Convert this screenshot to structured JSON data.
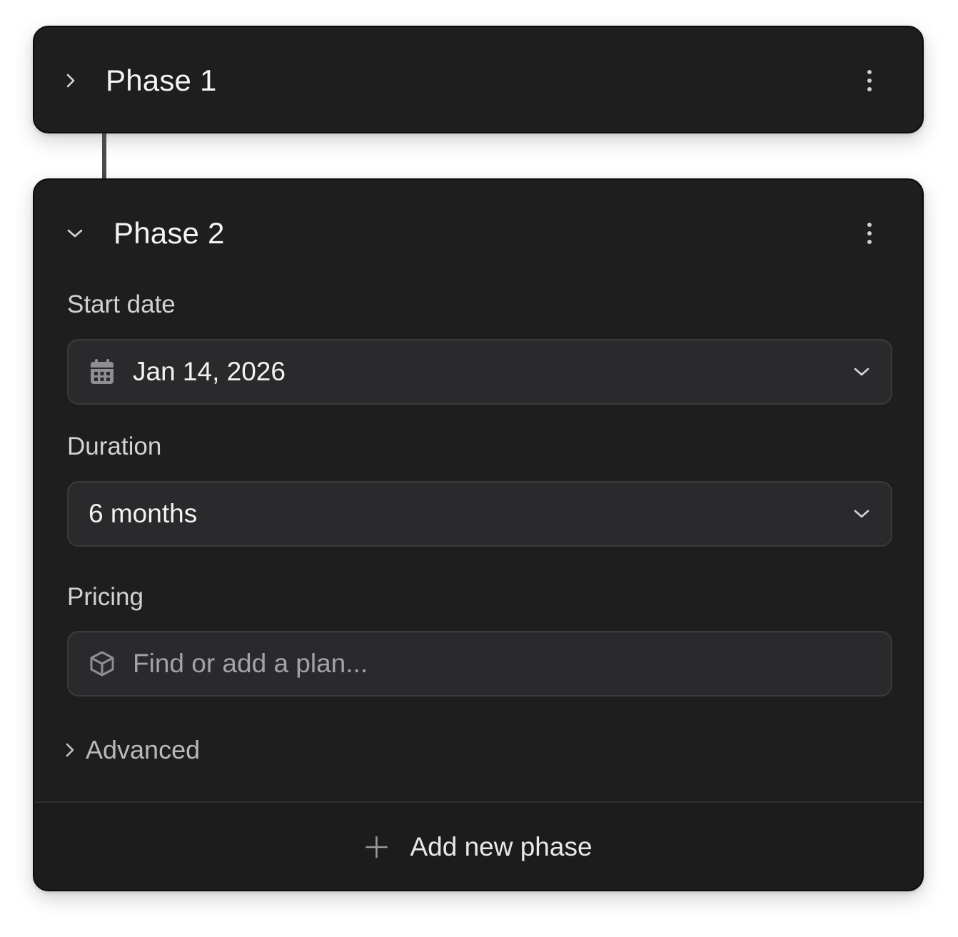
{
  "phases": [
    {
      "title": "Phase 1",
      "expanded": false
    },
    {
      "title": "Phase 2",
      "expanded": true,
      "start_date": {
        "label": "Start date",
        "value": "Jan 14, 2026",
        "icon": "calendar-icon"
      },
      "duration": {
        "label": "Duration",
        "value": "6 months"
      },
      "pricing": {
        "label": "Pricing",
        "placeholder": "Find or add a plan...",
        "icon": "package-icon"
      },
      "advanced_label": "Advanced"
    }
  ],
  "add_phase_label": "Add new phase",
  "colors": {
    "card_bg": "#1e1e1f",
    "field_bg": "#2a2a2c",
    "text_primary": "#f4f4f4",
    "text_secondary": "#a3a3a6"
  }
}
